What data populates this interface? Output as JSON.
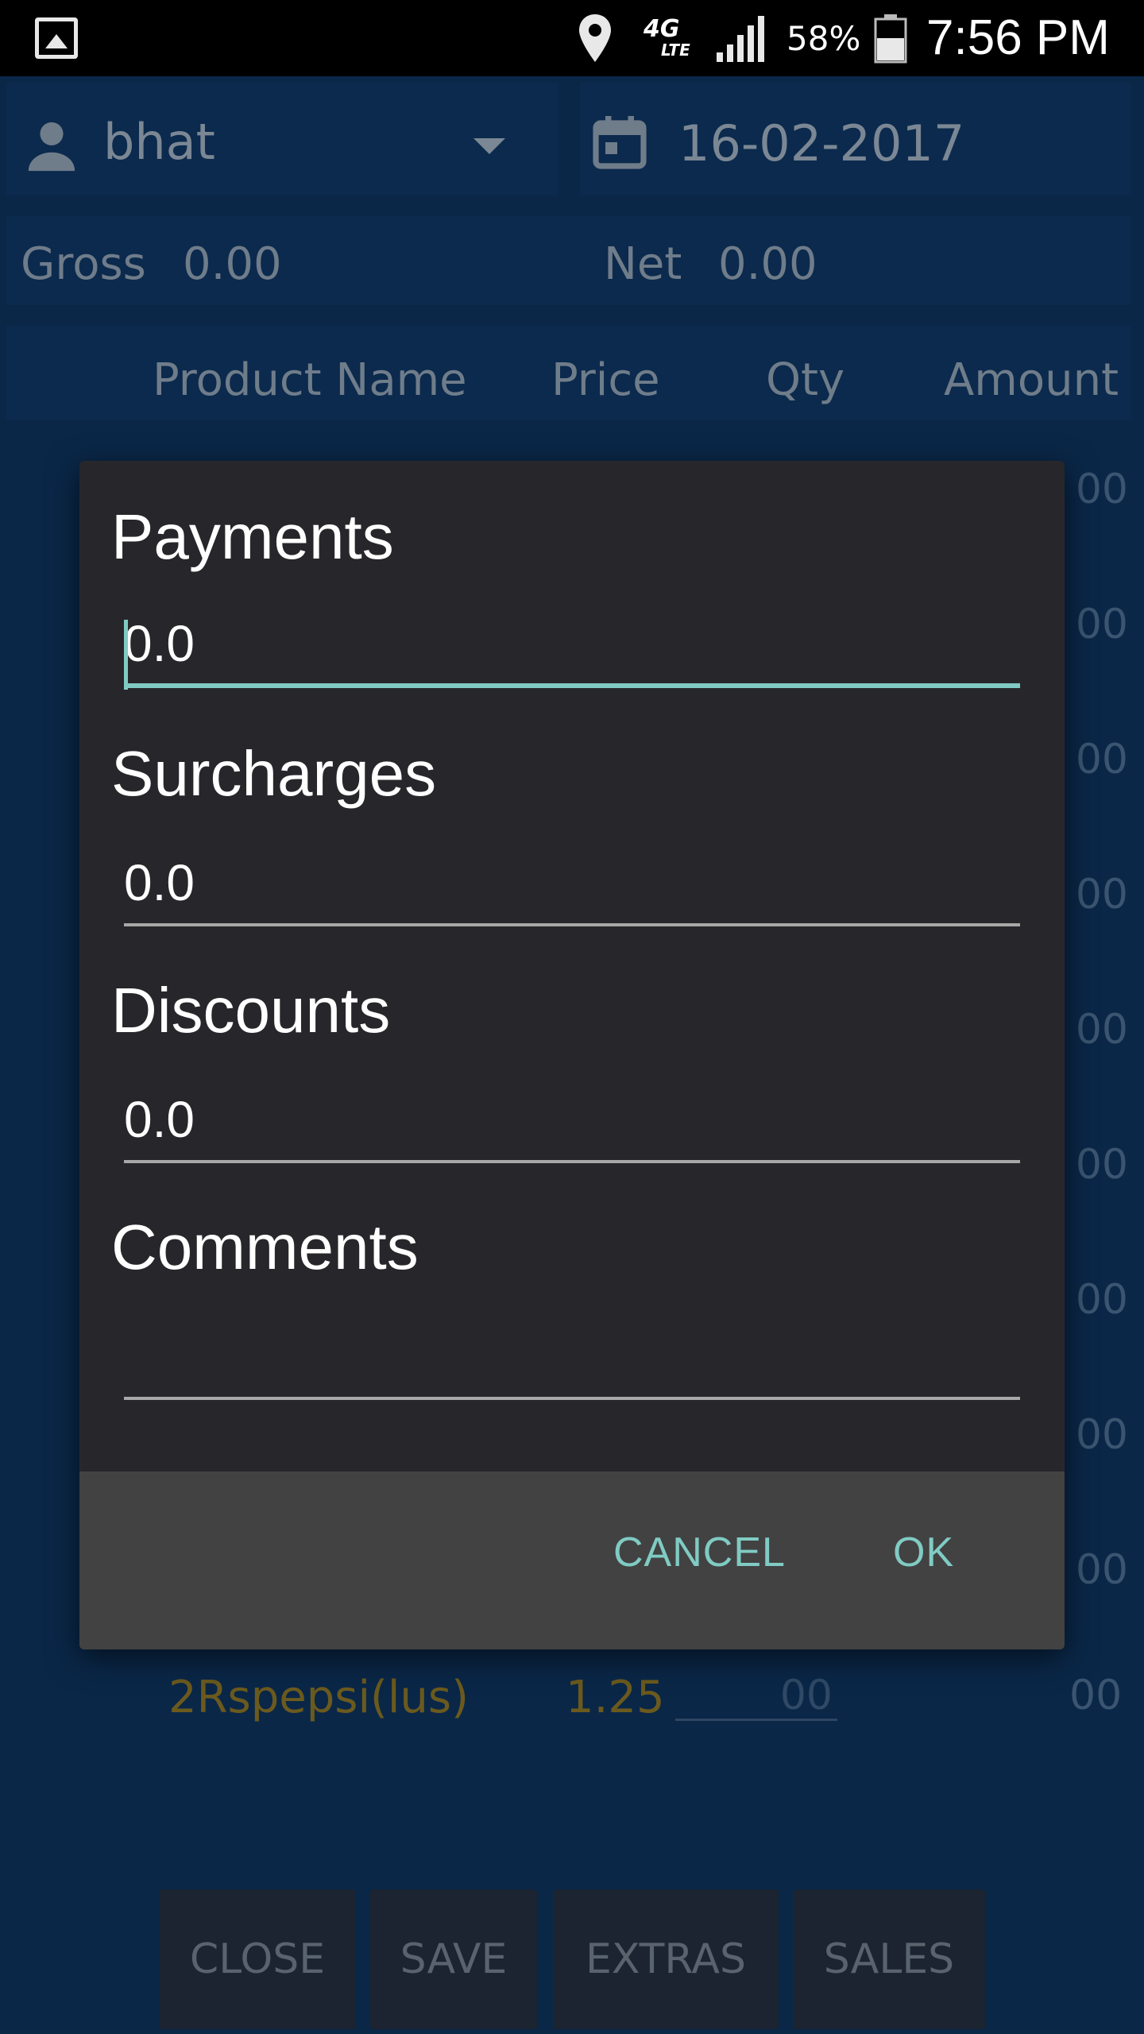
{
  "status_bar": {
    "battery_percent": "58%",
    "time": "7:56 PM",
    "network": "4G",
    "network_sub": "LTE",
    "icons": [
      "gallery-icon",
      "location-icon",
      "lte-icon",
      "signal-icon",
      "battery-icon"
    ]
  },
  "header": {
    "user": "bhat",
    "date": "16-02-2017"
  },
  "totals": {
    "gross_label": "Gross",
    "gross_value": "0.00",
    "net_label": "Net",
    "net_value": "0.00"
  },
  "table": {
    "columns": [
      "Product Name",
      "Price",
      "Qty",
      "Amount"
    ],
    "visible_amounts": [
      "00",
      "00",
      "00",
      "00",
      "00",
      "00",
      "00",
      "00",
      "00"
    ],
    "last_row": {
      "name": "2Rspepsi(lus)",
      "price": "1.25",
      "qty": "00",
      "amount": "00"
    }
  },
  "bottom_buttons": [
    "CLOSE",
    "SAVE",
    "EXTRAS",
    "SALES"
  ],
  "dialog": {
    "payments_label": "Payments",
    "payments_value": "0.0",
    "surcharges_label": "Surcharges",
    "surcharges_value": "0.0",
    "discounts_label": "Discounts",
    "discounts_value": "0.0",
    "comments_label": "Comments",
    "comments_value": "",
    "cancel_label": "CANCEL",
    "ok_label": "OK"
  },
  "colors": {
    "accent": "#80cbc4",
    "dialog_bg": "#27272b",
    "footer_bg": "#424242",
    "app_bg": "#0a2748"
  }
}
